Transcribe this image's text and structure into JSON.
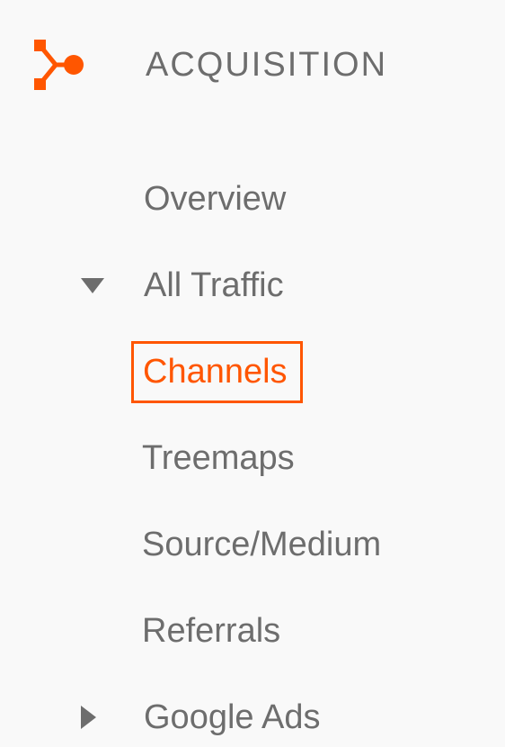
{
  "section": {
    "title": "ACQUISITION"
  },
  "nav": {
    "overview": "Overview",
    "all_traffic": {
      "label": "All Traffic",
      "children": {
        "channels": "Channels",
        "treemaps": "Treemaps",
        "source_medium": "Source/Medium",
        "referrals": "Referrals"
      }
    },
    "google_ads": "Google Ads"
  }
}
